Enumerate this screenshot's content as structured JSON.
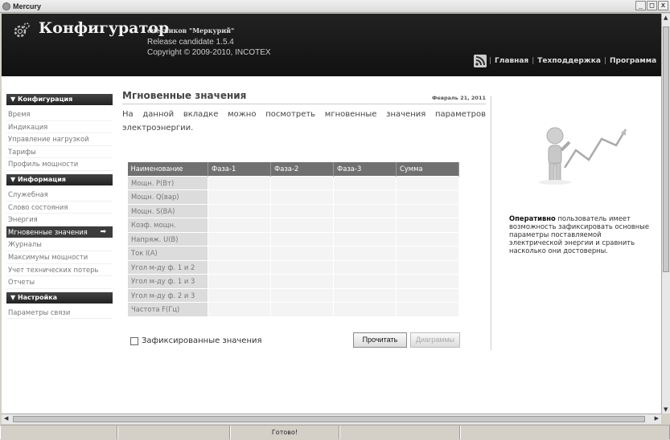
{
  "window": {
    "title": "Mercury",
    "min": "_",
    "max": "□",
    "close": "x"
  },
  "header": {
    "app_title": "Конфигуратор",
    "subtitle": "счетчиков \"Меркурий\"",
    "release": "Release candidate 1.5.4",
    "copyright": "Copyright © 2009-2010, INCOTEX",
    "nav": [
      "Главная",
      "Техподдержка",
      "Программа"
    ],
    "nav_sep": "|"
  },
  "sidebar": {
    "sections": [
      {
        "title": "▼ Конфигурация",
        "items": [
          "Время",
          "Индикация",
          "Управление нагрузкой",
          "Тарифы",
          "Профиль мощности"
        ]
      },
      {
        "title": "▼ Информация",
        "items": [
          "Служебная",
          "Слово состояния",
          "Энергия",
          "Мгновенные значения",
          "Журналы",
          "Максимумы мощности",
          "Учет технических потерь",
          "Отчеты"
        ]
      },
      {
        "title": "▼ Настройка",
        "items": [
          "Параметры связи"
        ]
      }
    ],
    "active_item": "Мгновенные значения",
    "active_arrow": "➡"
  },
  "main": {
    "title": "Мгновенные значения",
    "date": "Февраль 21, 2011",
    "intro": "На данной вкладке можно посмотреть мгновенные значения параметров электроэнергии.",
    "table": {
      "headers": [
        "Наименование",
        "Фаза-1",
        "Фаза-2",
        "Фаза-3",
        "Сумма"
      ],
      "rows": [
        "Мощн. P(Вт)",
        "Мощн. Q(вар)",
        "Мощн. S(ВА)",
        "Коэф. мощн.",
        "Напряж. U(В)",
        "Ток I(А)",
        "Угол м-ду ф. 1 и 2",
        "Угол м-ду ф. 1 и 3",
        "Угол м-ду ф. 2 и 3",
        "Частота F(Гц)"
      ]
    },
    "checkbox_label": "Зафиксированные значения",
    "read_button": "Прочитать",
    "diagram_button": "Диаграммы"
  },
  "right_panel": {
    "bold_word": "Оперативно",
    "text": " пользователь имеет возможность зафиксировать основные параметры поставляемой электрической энергии и сравнить насколько они достоверны."
  },
  "statusbar": {
    "text": "Готово!"
  },
  "colors": {
    "header_bg": "#1a1a1a",
    "sidebar_head": "#333333",
    "table_head": "#707070",
    "accent_arrow": "#dd5533"
  }
}
